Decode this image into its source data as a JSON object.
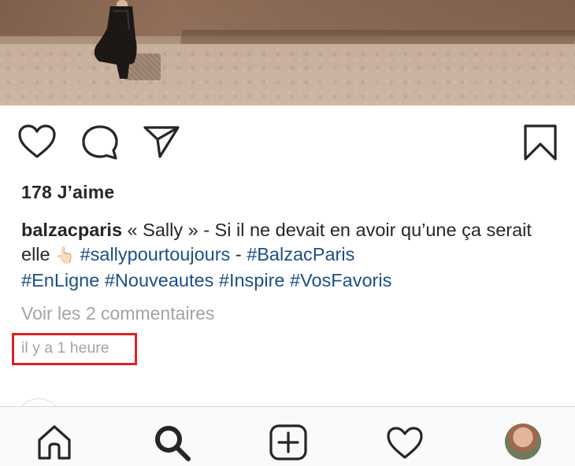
{
  "post": {
    "likes_label": "178 J’aime",
    "caption": {
      "username": "balzacparis",
      "text_part1": " « Sally » - Si il ne devait en avoir qu’une ça serait elle ",
      "emoji": "👆🏻",
      "text_space": " ",
      "hashtag1": "#sallypourtoujours",
      "separator": " - ",
      "hashtag2": "#BalzacParis",
      "hashtag3": "#EnLigne",
      "hashtag4": "#Nouveautes",
      "hashtag5": "#Inspire",
      "hashtag6": "#VosFavoris"
    },
    "comments_link": "Voir les 2 commentaires",
    "timestamp": "il y a 1 heure"
  },
  "icons": {
    "like": "heart-icon",
    "comment": "comment-bubble-icon",
    "share": "paper-plane-icon",
    "save": "bookmark-icon"
  },
  "tabbar": {
    "tabs": [
      "home-icon",
      "search-icon",
      "new-post-icon",
      "activity-heart-icon",
      "profile-avatar"
    ]
  },
  "colors": {
    "hashtag": "#1b4f86",
    "secondary_text": "#a3a3a3",
    "highlight_box": "#e0201c"
  }
}
